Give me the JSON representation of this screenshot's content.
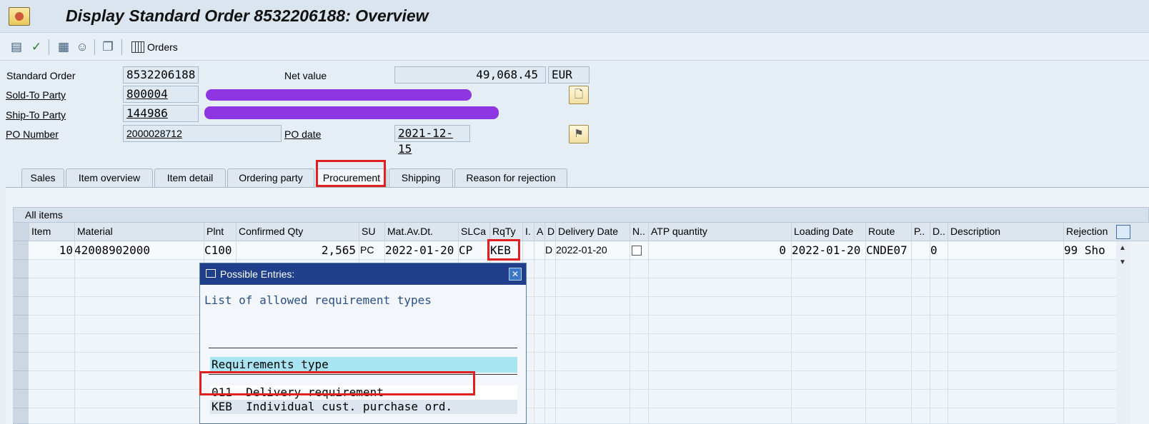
{
  "window": {
    "title": "Display Standard Order 8532206188: Overview"
  },
  "toolbar": {
    "orders_label": "Orders"
  },
  "header": {
    "standard_order_label": "Standard Order",
    "standard_order_value": "8532206188",
    "sold_to_label": "Sold-To Party",
    "sold_to_value": "800004",
    "ship_to_label": "Ship-To Party",
    "ship_to_value": "144986",
    "po_number_label": "PO Number",
    "po_number_value": "2000028712",
    "net_value_label": "Net value",
    "net_value": "49,068.45",
    "currency": "EUR",
    "po_date_label": "PO date",
    "po_date_value": "2021-12-15"
  },
  "tabs": [
    {
      "label": "Sales"
    },
    {
      "label": "Item overview"
    },
    {
      "label": "Item detail"
    },
    {
      "label": "Ordering party"
    },
    {
      "label": "Procurement"
    },
    {
      "label": "Shipping"
    },
    {
      "label": "Reason for rejection"
    }
  ],
  "table": {
    "title": "All items",
    "columns": [
      "Item",
      "Material",
      "Plnt",
      "Confirmed Qty",
      "SU",
      "Mat.Av.Dt.",
      "SLCa",
      "RqTy",
      "I.",
      "A",
      "D",
      "Delivery Date",
      "N..",
      "ATP quantity",
      "Loading Date",
      "Route",
      "P..",
      "D..",
      "Description",
      "Rejection"
    ],
    "rows": [
      {
        "item": "10",
        "material": "42008902000",
        "plnt": "C100",
        "confirmed_qty": "2,565",
        "su": "PC",
        "mat_av_dt": "2022-01-20",
        "slca": "CP",
        "rqty": "KEB",
        "d": "D",
        "delivery_date": "2022-01-20",
        "atp_quantity": "0",
        "loading_date": "2022-01-20",
        "route": "CNDE07",
        "d2": "0",
        "rejection": "99 Sho"
      }
    ]
  },
  "dialog": {
    "title": "Possible Entries:",
    "heading": "List of allowed requirement types",
    "column_header": "Requirements type",
    "entries": [
      {
        "code": "011",
        "text": "Delivery requirement"
      },
      {
        "code": "KEB",
        "text": "Individual cust. purchase ord."
      }
    ]
  },
  "colors": {
    "highlight_red": "#e02020",
    "dialog_title_bg": "#1f3f8a",
    "redaction": "#8a2be2"
  }
}
